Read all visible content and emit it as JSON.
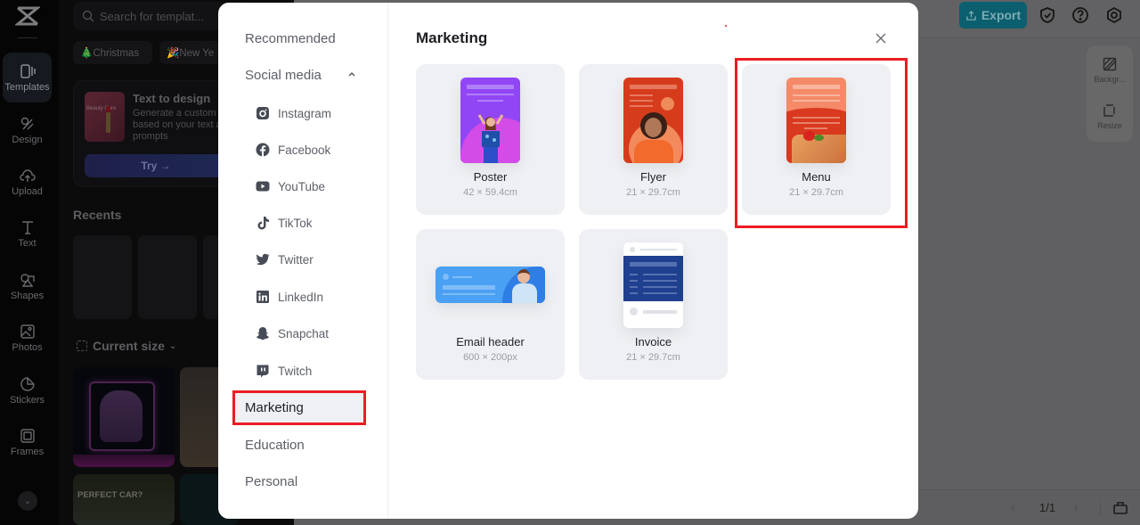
{
  "app": {
    "logo": "capcut-logo",
    "rail": [
      {
        "label": "Templates",
        "icon": "templates-icon",
        "active": true
      },
      {
        "label": "Design",
        "icon": "design-icon"
      },
      {
        "label": "Upload",
        "icon": "upload-icon"
      },
      {
        "label": "Text",
        "icon": "text-icon"
      },
      {
        "label": "Shapes",
        "icon": "shapes-icon"
      },
      {
        "label": "Photos",
        "icon": "photos-icon"
      },
      {
        "label": "Stickers",
        "icon": "stickers-icon"
      },
      {
        "label": "Frames",
        "icon": "frames-icon"
      }
    ]
  },
  "panel": {
    "search_placeholder": "Search for templat...",
    "chips": [
      "🎄Christmas",
      "🎉New Ye"
    ],
    "text_to_design": {
      "thumb_text": "Beauty Care",
      "title": "Text to design",
      "description": "Generate a custom design based on your text and image prompts",
      "button": "Try →"
    },
    "recents_title": "Recents",
    "current_size": "Current size",
    "template_caption": "PERFECT CAR?"
  },
  "topbar": {
    "export_label": "Export",
    "icons": [
      "shield-check-icon",
      "help-icon",
      "settings-icon"
    ]
  },
  "side_tools": [
    {
      "label": "Backgr...",
      "icon": "background-icon"
    },
    {
      "label": "Resize",
      "icon": "resize-icon"
    }
  ],
  "bottombar": {
    "page": "1/1",
    "prev": "‹",
    "next": "›"
  },
  "modal": {
    "nav": {
      "recommended": "Recommended",
      "social_media": "Social media",
      "social_items": [
        {
          "label": "Instagram",
          "icon": "instagram-icon"
        },
        {
          "label": "Facebook",
          "icon": "facebook-icon"
        },
        {
          "label": "YouTube",
          "icon": "youtube-icon"
        },
        {
          "label": "TikTok",
          "icon": "tiktok-icon"
        },
        {
          "label": "Twitter",
          "icon": "twitter-icon"
        },
        {
          "label": "LinkedIn",
          "icon": "linkedin-icon"
        },
        {
          "label": "Snapchat",
          "icon": "snapchat-icon"
        },
        {
          "label": "Twitch",
          "icon": "twitch-icon"
        }
      ],
      "marketing": "Marketing",
      "education": "Education",
      "personal": "Personal",
      "active": "Marketing"
    },
    "title": "Marketing",
    "cards": [
      {
        "name": "Poster",
        "size": "42 × 59.4cm"
      },
      {
        "name": "Flyer",
        "size": "21 × 29.7cm"
      },
      {
        "name": "Menu",
        "size": "21 × 29.7cm",
        "highlighted": true
      },
      {
        "name": "Email header",
        "size": "600 × 200px"
      },
      {
        "name": "Invoice",
        "size": "21 × 29.7cm"
      }
    ],
    "highlight_color": "#ec1c24"
  }
}
